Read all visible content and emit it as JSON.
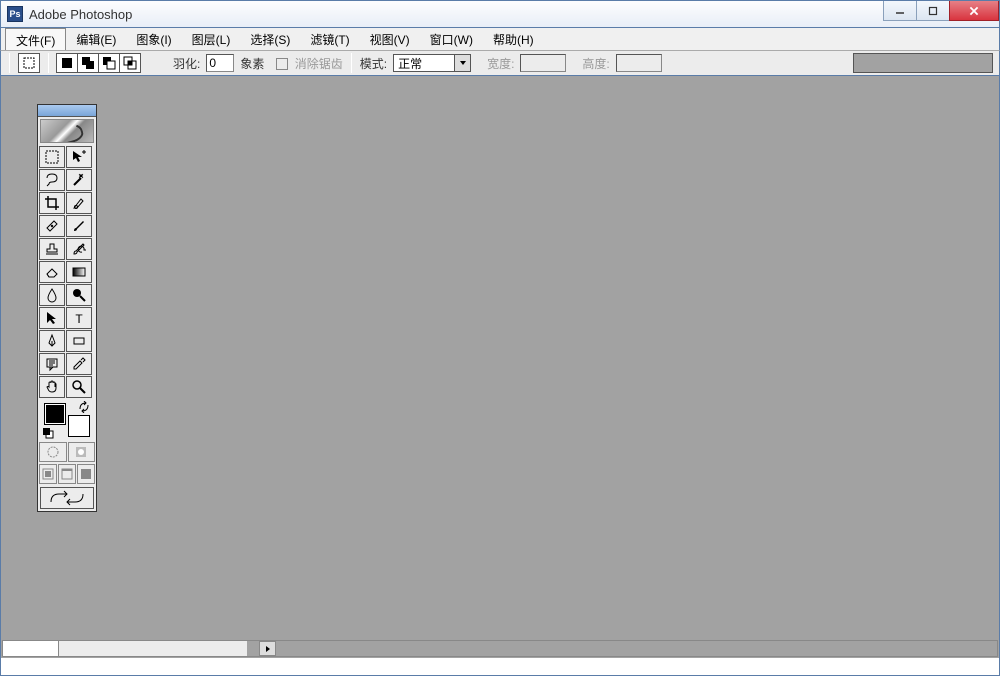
{
  "app": {
    "icon_label": "Ps",
    "title": "Adobe Photoshop"
  },
  "menu": {
    "items": [
      {
        "label": "文件(F)",
        "active": true
      },
      {
        "label": "编辑(E)",
        "active": false
      },
      {
        "label": "图象(I)",
        "active": false
      },
      {
        "label": "图层(L)",
        "active": false
      },
      {
        "label": "选择(S)",
        "active": false
      },
      {
        "label": "滤镜(T)",
        "active": false
      },
      {
        "label": "视图(V)",
        "active": false
      },
      {
        "label": "窗口(W)",
        "active": false
      },
      {
        "label": "帮助(H)",
        "active": false
      }
    ]
  },
  "options": {
    "feather_label": "羽化:",
    "feather_value": "0",
    "feather_unit": "象素",
    "antialias_label": "消除锯齿",
    "mode_label": "模式:",
    "mode_value": "正常",
    "width_label": "宽度:",
    "height_label": "高度:"
  },
  "tools": {
    "list": [
      "marquee",
      "move",
      "lasso",
      "wand",
      "crop",
      "slice",
      "healing",
      "brush",
      "stamp",
      "history-brush",
      "eraser",
      "gradient",
      "blur",
      "dodge",
      "path-select",
      "type",
      "pen",
      "shape",
      "notes",
      "eyedropper",
      "hand",
      "zoom"
    ]
  }
}
